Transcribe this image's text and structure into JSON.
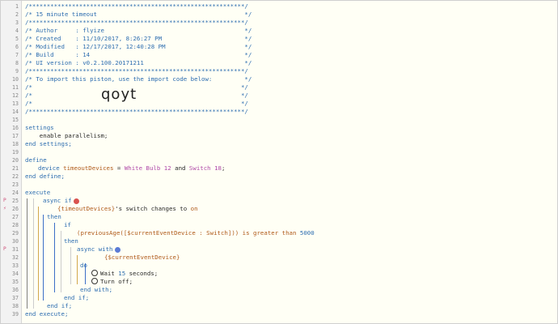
{
  "lines": [
    {
      "n": "1",
      "text": "/************************************************************/"
    },
    {
      "n": "2",
      "text": "/* 15 minute timeout                                         */"
    },
    {
      "n": "3",
      "text": "/************************************************************/"
    },
    {
      "n": "4",
      "text": "/* Author     : flyize                                       */"
    },
    {
      "n": "5",
      "text": "/* Created    : 11/10/2017, 8:26:27 PM                       */"
    },
    {
      "n": "6",
      "text": "/* Modified   : 12/17/2017, 12:40:28 PM                      */"
    },
    {
      "n": "7",
      "text": "/* Build      : 14                                           */"
    },
    {
      "n": "8",
      "text": "/* UI version : v0.2.100.20171211                            */"
    },
    {
      "n": "9",
      "text": "/************************************************************/"
    },
    {
      "n": "10",
      "text": "/* To import this piston, use the import code below:         */"
    },
    {
      "n": "11",
      "text": "/*                                                          */"
    },
    {
      "n": "12",
      "text": "/*                                                          */"
    },
    {
      "n": "13",
      "text": "/*                                                          */"
    },
    {
      "n": "14",
      "text": "/************************************************************/"
    },
    {
      "n": "15",
      "text": ""
    },
    {
      "n": "16",
      "text": "settings"
    },
    {
      "n": "17",
      "text": "    enable parallelism;"
    },
    {
      "n": "18",
      "text": "end settings;"
    },
    {
      "n": "19",
      "text": ""
    },
    {
      "n": "20",
      "text": "define"
    },
    {
      "n": "21",
      "text": ""
    },
    {
      "n": "22",
      "text": "end define;"
    },
    {
      "n": "23",
      "text": ""
    },
    {
      "n": "24",
      "text": "execute"
    },
    {
      "n": "25",
      "text": ""
    },
    {
      "n": "26",
      "text": ""
    },
    {
      "n": "27",
      "text": "then"
    },
    {
      "n": "28",
      "text": "if"
    },
    {
      "n": "29",
      "text": ""
    },
    {
      "n": "30",
      "text": "then"
    },
    {
      "n": "31",
      "text": ""
    },
    {
      "n": "32",
      "text": "{$currentEventDevice}"
    },
    {
      "n": "33",
      "text": "do"
    },
    {
      "n": "34",
      "text": ""
    },
    {
      "n": "35",
      "text": ""
    },
    {
      "n": "36",
      "text": "end with;"
    },
    {
      "n": "37",
      "text": "end if;"
    },
    {
      "n": "38",
      "text": "end if;"
    },
    {
      "n": "39",
      "text": "end execute;"
    }
  ],
  "import_code": "qoyt",
  "line21": {
    "kw": "device",
    "var": "timeoutDevices",
    "eq": " = ",
    "dev1": "White Bulb 12",
    "and": " and ",
    "dev2": "Switch 18",
    "end": ";"
  },
  "line25": {
    "kw": "async if"
  },
  "line26": {
    "var": "{timeoutDevices}",
    "rest": "'s switch changes to ",
    "val": "on"
  },
  "line29": {
    "text": "(previousAge([$currentEventDevice : Switch])) is greater than ",
    "num": "5000"
  },
  "line31": {
    "kw": "async with"
  },
  "line34": {
    "kw": "Wait ",
    "num": "15",
    "rest": " seconds;"
  },
  "line35": {
    "text": "Turn off;"
  },
  "markers": {
    "m25": "P",
    "m26": "⚡",
    "m31": "P"
  },
  "colors": {
    "comment": "#2d6db0",
    "keyword": "#2d6db0",
    "variable": "#b05a1a",
    "device": "#b04aa8",
    "marker": "#d0507a"
  }
}
